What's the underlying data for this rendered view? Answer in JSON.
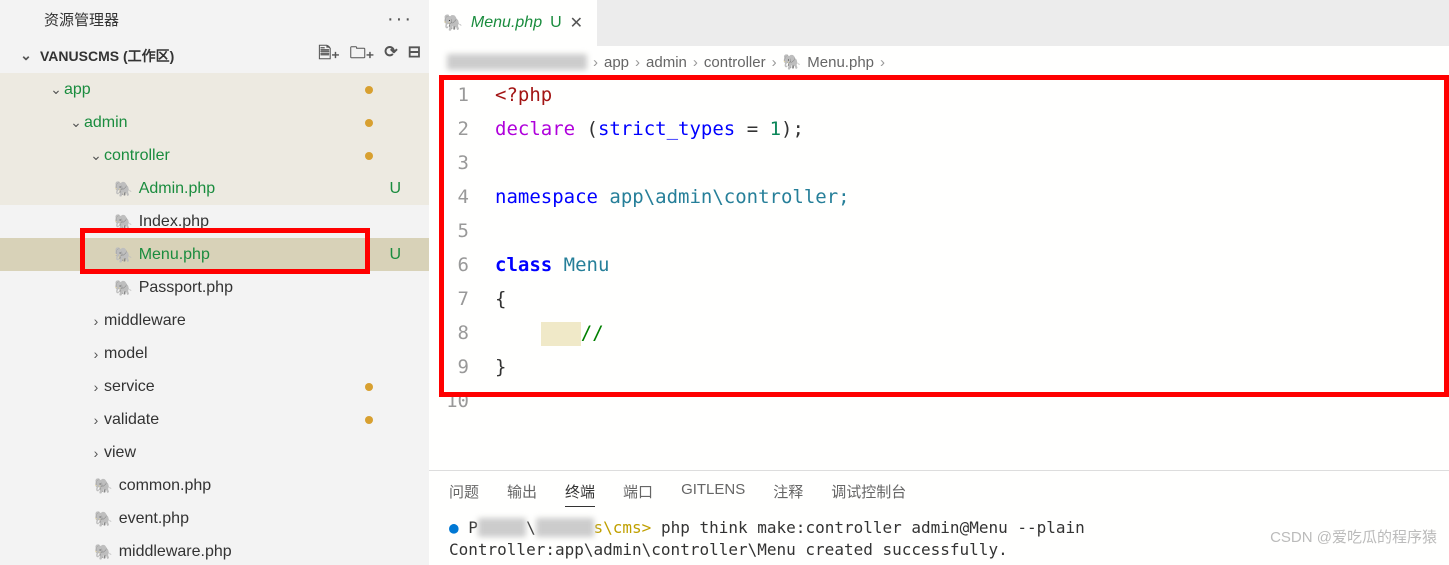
{
  "sidebar": {
    "title": "资源管理器",
    "workspace": "VANUSCMS (工作区)",
    "tree": {
      "app": "app",
      "admin": "admin",
      "controller": "controller",
      "files": {
        "admin_php": "Admin.php",
        "index_php": "Index.php",
        "menu_php": "Menu.php",
        "passport_php": "Passport.php"
      },
      "folders": {
        "middleware": "middleware",
        "model": "model",
        "service": "service",
        "validate": "validate",
        "view": "view"
      },
      "root_files": {
        "common_php": "common.php",
        "event_php": "event.php",
        "middleware_php": "middleware.php"
      }
    },
    "status_u": "U"
  },
  "tab": {
    "name": "Menu.php",
    "status": "U"
  },
  "breadcrumb": {
    "p1": "app",
    "p2": "admin",
    "p3": "controller",
    "p4": "Menu.php"
  },
  "code": {
    "l1_open": "<?php",
    "l2_declare": "declare",
    "l2_strict": "strict_types",
    "l2_eq": " = ",
    "l2_one": "1",
    "l4_ns": "namespace",
    "l4_path": " app\\admin\\controller;",
    "l6_class": "class",
    "l6_name": " Menu",
    "l7": "{",
    "l8_comment": "//",
    "l9": "}"
  },
  "panel": {
    "tabs": {
      "problems": "问题",
      "output": "输出",
      "terminal": "终端",
      "ports": "端口",
      "gitlens": "GITLENS",
      "comments": "注释",
      "debug": "调试控制台"
    },
    "terminal": {
      "prompt_suffix": "s\\cms>",
      "cmd": " php think make:controller admin@Menu --plain",
      "result": "Controller:app\\admin\\controller\\Menu created successfully."
    }
  },
  "watermark": "CSDN @爱吃瓜的程序猿"
}
